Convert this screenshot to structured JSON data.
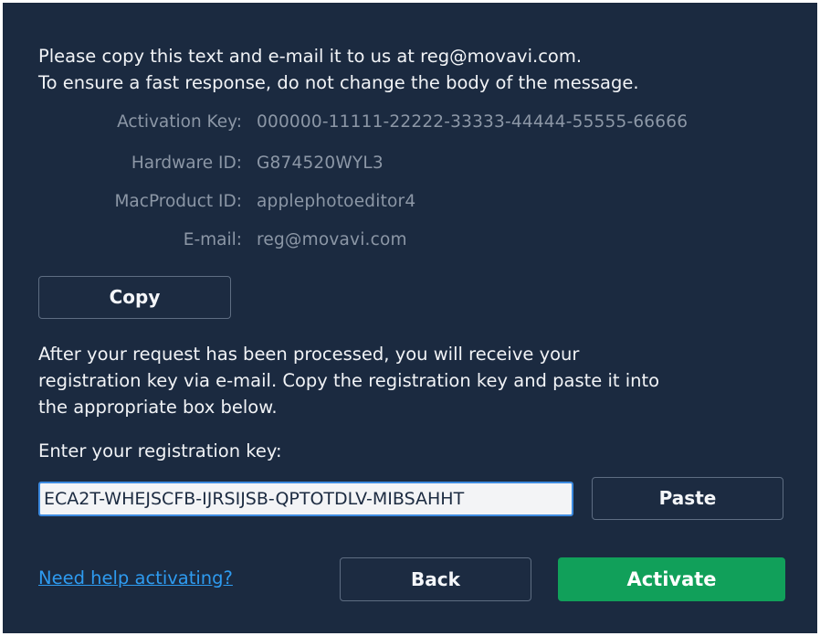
{
  "intro": {
    "line1": "Please copy this text and e-mail it to us at reg@movavi.com.",
    "line2": "To ensure a fast response, do not change the body of the message."
  },
  "info": {
    "activation_key_label": "Activation Key:",
    "activation_key_value": "000000-11111-22222-33333-44444-55555-66666",
    "hardware_id_label": "Hardware ID:",
    "hardware_id_value": "G874520WYL3",
    "product_id_label": "MacProduct ID:",
    "product_id_value": "applephotoeditor4",
    "email_label": "E-mail:",
    "email_value": "reg@movavi.com"
  },
  "buttons": {
    "copy": "Copy",
    "paste": "Paste",
    "back": "Back",
    "activate": "Activate"
  },
  "processed": {
    "line1": "After your request has been processed, you will receive your",
    "line2": "registration key via e-mail. Copy the registration key and paste it into",
    "line3": "the appropriate box below."
  },
  "registration": {
    "label": "Enter your registration key:",
    "value": "ECA2T-WHEJSCFB-IJRSIJSB-QPTOTDLV-MIBSAHHT"
  },
  "help_link": "Need help activating?",
  "colors": {
    "background": "#1b2a40",
    "accent_green": "#11a05a",
    "link_blue": "#2e9bf0",
    "focus_blue": "#3d8be0"
  }
}
